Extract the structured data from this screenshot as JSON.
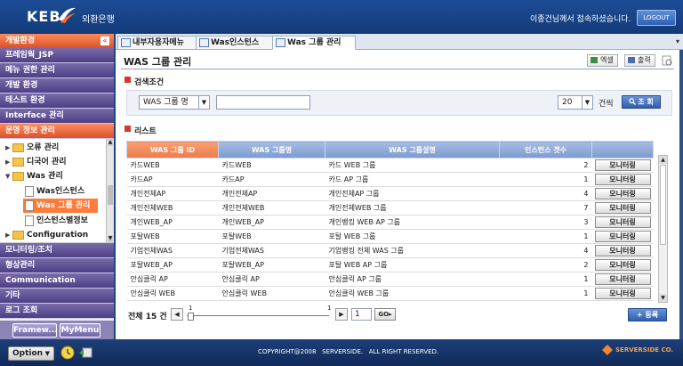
{
  "header": {
    "logo": "KEB",
    "logo_sub": "외환은행",
    "welcome": "이종건님께서 접속하셨습니다.",
    "logout": "LOGOUT"
  },
  "sidebar": {
    "title": "개발환경",
    "collapse_glyph": "«",
    "menus_top": [
      "프레임웍_JSP",
      "메뉴 권한 관리",
      "개발 환경",
      "테스트 환경",
      "Interface 관리",
      "운영 정보 관리"
    ],
    "tree": [
      {
        "label": "오류 관리",
        "type": "folder",
        "twisty": "▶"
      },
      {
        "label": "디국어 관리",
        "type": "folder",
        "twisty": "▶"
      },
      {
        "label": "Was 관리",
        "type": "folder",
        "twisty": "▼"
      },
      {
        "label": "Was인스턴스",
        "type": "file"
      },
      {
        "label": "Was 그룹 관리",
        "type": "file",
        "selected": true
      },
      {
        "label": "인스턴스별정보",
        "type": "file"
      },
      {
        "label": "Configuration",
        "type": "folder",
        "twisty": "▶"
      }
    ],
    "menus_bottom": [
      "모니터링/조치",
      "형상관리",
      "Communication",
      "기타",
      "로그 조회"
    ],
    "buttons": [
      "Framew...",
      "MyMenu"
    ]
  },
  "tabs": [
    {
      "label": "내부자용자메뉴"
    },
    {
      "label": "Was인스턴스"
    },
    {
      "label": "Was 그룹 관리",
      "active": true
    }
  ],
  "page": {
    "title": "WAS 그룹 관리",
    "excel_label": "엑셀",
    "print_label": "출력"
  },
  "search": {
    "section_title": "검색조건",
    "field_select": "WAS 그룹 명",
    "text_value": "",
    "page_size": "20",
    "page_size_suffix": "건씩",
    "search_button": "조 회"
  },
  "list": {
    "section_title": "리스트",
    "columns": [
      "WAS 그룹 ID",
      "WAS 그룹명",
      "WAS 그룹설명",
      "인스턴스 갯수",
      ""
    ],
    "action_label": "모니터링",
    "rows": [
      [
        "카드WEB",
        "카드WEB",
        "카드 WEB 그룹",
        "2"
      ],
      [
        "카드AP",
        "카드AP",
        "카드 AP 그룹",
        "1"
      ],
      [
        "개인전체AP",
        "개인전체AP",
        "개인전체AP 그룹",
        "4"
      ],
      [
        "개인전체WEB",
        "개인전체WEB",
        "개인전체WEB 그룹",
        "7"
      ],
      [
        "개인WEB_AP",
        "개인WEB_AP",
        "개인뱅킹 WEB AP 그룹",
        "3"
      ],
      [
        "포탈WEB",
        "포탈WEB",
        "포탈 WEB 그룹",
        "1"
      ],
      [
        "기업전체WAS",
        "기업전체WAS",
        "기업뱅킹 전체 WAS 그룹",
        "4"
      ],
      [
        "포탈WEB_AP",
        "포탈WEB_AP",
        "포탈 WEB AP 그룹",
        "2"
      ],
      [
        "안심클릭 AP",
        "안심클릭 AP",
        "안심클릭 AP 그룹",
        "1"
      ],
      [
        "안심클릭 WEB",
        "안심클릭 WEB",
        "안심클릭 WEB 그룹",
        "1"
      ]
    ]
  },
  "pager": {
    "total": "전체 15 건",
    "slider_left": "1",
    "slider_right": "1",
    "page_value": "1",
    "go_label": "GO",
    "register_label": "등록"
  },
  "footer": {
    "option": "Option",
    "copyright": "COPYRIGHT@2008   SERVERSIDE.   ALL RIGHT RESERVED.",
    "brand": "SERVERSIDE CO."
  },
  "colors": {
    "accent": "#d9532b",
    "menu": "#4d3f86",
    "header": "#1d4d97"
  }
}
